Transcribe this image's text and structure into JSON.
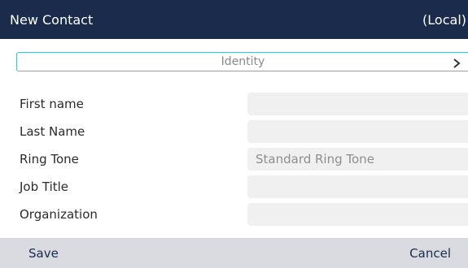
{
  "header": {
    "title": "New Contact",
    "location": "(Local)"
  },
  "section": {
    "label": "Identity",
    "icon": "chevron-right-icon"
  },
  "fields": [
    {
      "label": "First name",
      "value": ""
    },
    {
      "label": "Last Name",
      "value": ""
    },
    {
      "label": "Ring Tone",
      "value": "Standard Ring Tone"
    },
    {
      "label": "Job Title",
      "value": ""
    },
    {
      "label": "Organization",
      "value": ""
    }
  ],
  "softkeys": {
    "left": "Save",
    "right": "Cancel"
  },
  "colors": {
    "header_bg": "#1b2b4b",
    "accent": "#5ab6c4",
    "field_bg": "#f0f0f0",
    "softkey_bg": "#d9dbe0"
  }
}
